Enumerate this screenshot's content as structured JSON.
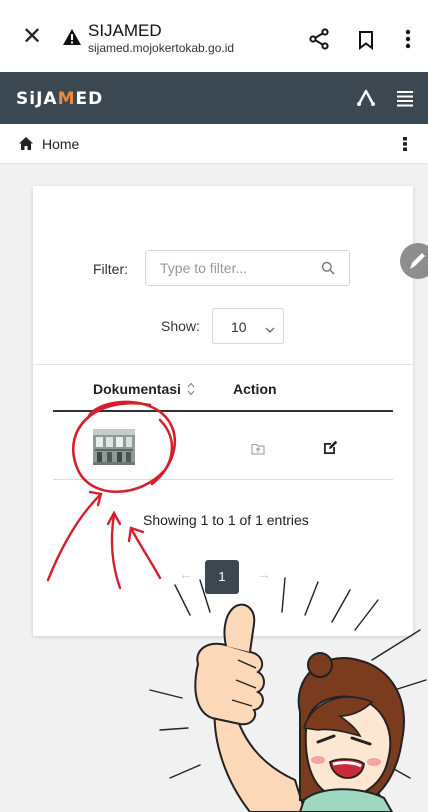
{
  "browser": {
    "title": "SIJAMED",
    "url": "sijamed.mojokertokab.go.id"
  },
  "header": {
    "logo_prefix": "SiJA",
    "logo_accent": "M",
    "logo_suffix": "ED"
  },
  "breadcrumb": {
    "home": "Home"
  },
  "table": {
    "filter_label": "Filter:",
    "filter_placeholder": "Type to filter...",
    "show_label": "Show:",
    "show_value": "10",
    "columns": [
      "Dokumentasi",
      "Action"
    ],
    "info": "Showing 1 to 1 of 1 entries",
    "prev": "←",
    "page": "1",
    "next": "→"
  },
  "icons": {
    "close": "close-icon",
    "warning": "warning-icon",
    "share": "share-icon",
    "bookmark": "bookmark-icon",
    "more": "more-vertical-icon",
    "tri": "triangle-nodes-icon",
    "menu": "hamburger-menu-icon",
    "home": "home-icon",
    "search": "search-icon",
    "sort": "sort-icon",
    "upload": "folder-upload-icon",
    "edit": "edit-icon"
  },
  "colors": {
    "header_bg": "#3b4852",
    "accent": "#f08a3a",
    "annotation": "#d4202c"
  }
}
